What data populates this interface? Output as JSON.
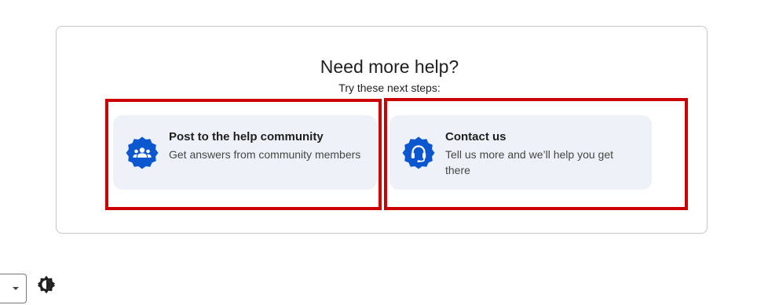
{
  "help": {
    "title": "Need more help?",
    "subtitle": "Try these next steps:"
  },
  "cards": {
    "community": {
      "icon": "people-group-icon",
      "title": "Post to the help community",
      "description": "Get answers from community members"
    },
    "contact": {
      "icon": "headset-icon",
      "title": "Contact us",
      "description": "Tell us more and we’ll help you get there"
    }
  },
  "footer": {
    "select_icon": "chevron-down-icon",
    "theme_icon": "brightness-icon"
  },
  "colors": {
    "accent": "#0b57d0",
    "card_bg": "#eef1f7",
    "highlight": "#cc0000"
  }
}
